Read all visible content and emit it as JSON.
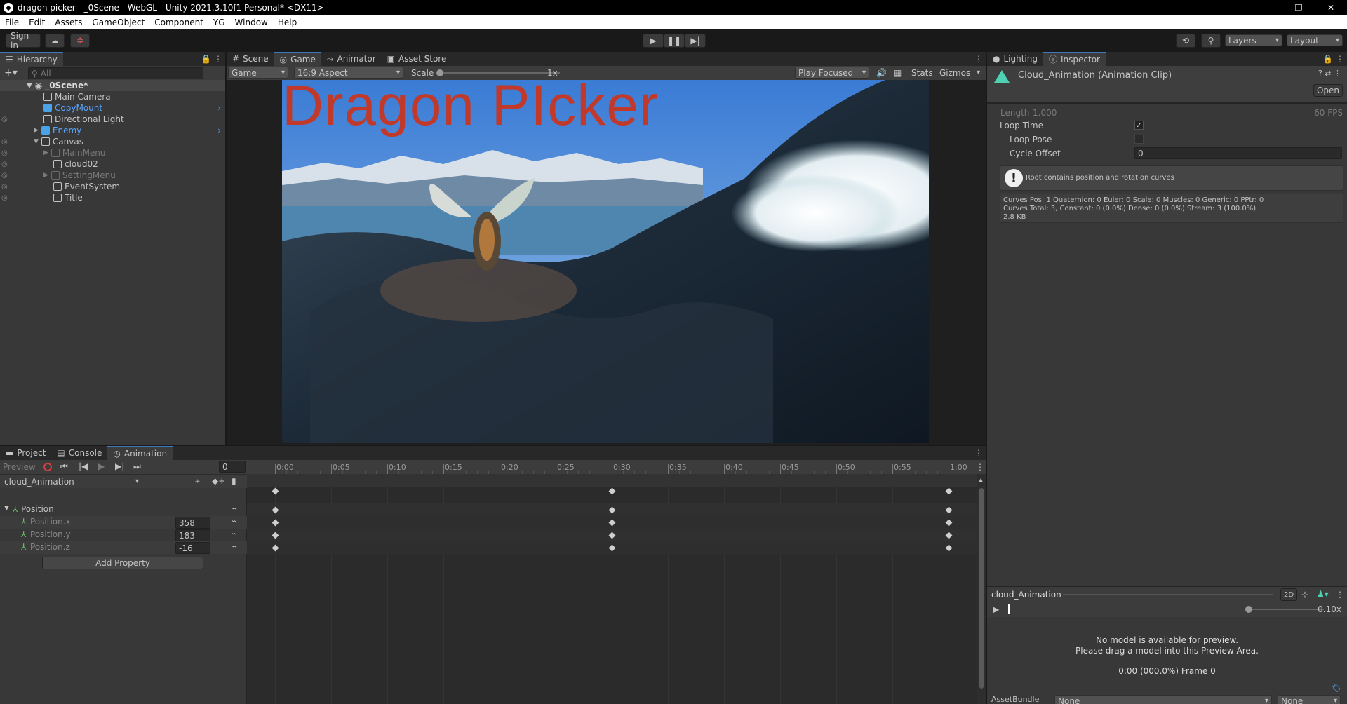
{
  "window": {
    "title": "dragon picker - _0Scene - WebGL - Unity 2021.3.10f1 Personal* <DX11>",
    "controls": [
      "—",
      "❐",
      "✕"
    ]
  },
  "menu": [
    "File",
    "Edit",
    "Assets",
    "GameObject",
    "Component",
    "YG",
    "Window",
    "Help"
  ],
  "toolbar": {
    "sign_in": "Sign in",
    "layers": "Layers",
    "layout": "Layout"
  },
  "hierarchy": {
    "tab": "Hierarchy",
    "search_placeholder": "All",
    "scene": "_0Scene*",
    "items": [
      {
        "label": "Main Camera",
        "color": "#c4c4c4"
      },
      {
        "label": "CopyMount",
        "color": "#58a6ff"
      },
      {
        "label": "Directional Light",
        "color": "#c4c4c4"
      },
      {
        "label": "Enemy",
        "color": "#58a6ff"
      },
      {
        "label": "Canvas",
        "color": "#c4c4c4"
      },
      {
        "label": "MainMenu",
        "color": "#7a7a7a"
      },
      {
        "label": "cloud02",
        "color": "#c4c4c4"
      },
      {
        "label": "SettingMenu",
        "color": "#7a7a7a"
      },
      {
        "label": "EventSystem",
        "color": "#c4c4c4"
      },
      {
        "label": "Title",
        "color": "#c4c4c4"
      }
    ]
  },
  "center_tabs": {
    "scene": "Scene",
    "game": "Game",
    "animator": "Animator",
    "asset_store": "Asset Store"
  },
  "game_toolbar": {
    "display": "Game",
    "aspect": "16:9 Aspect",
    "scale_label": "Scale",
    "scale_value": "1x",
    "play_mode": "Play Focused",
    "stats": "Stats",
    "gizmos": "Gizmos"
  },
  "game_view": {
    "title": "Dragon PIcker"
  },
  "right_tabs": {
    "lighting": "Lighting",
    "inspector": "Inspector"
  },
  "inspector": {
    "header": "Cloud_Animation (Animation Clip)",
    "open": "Open",
    "length_label": "Length",
    "length_value": "1.000",
    "fps": "60 FPS",
    "loop_time": "Loop Time",
    "loop_pose": "Loop Pose",
    "cycle_offset": "Cycle Offset",
    "cycle_offset_value": "0",
    "warning": "Root contains position and rotation curves",
    "curves_line1": "Curves Pos: 1 Quaternion: 0 Euler: 0 Scale: 0 Muscles: 0 Generic: 0 PPtr: 0",
    "curves_line2": "Curves Total: 3, Constant: 0 (0.0%) Dense: 0 (0.0%) Stream: 3 (100.0%)",
    "curves_line3": "2.8 KB"
  },
  "preview": {
    "clip": "cloud_Animation",
    "mode2d": "2D",
    "speed": "0.10x",
    "msg1": "No model is available for preview.",
    "msg2": "Please drag a model into this Preview Area.",
    "time": "0:00 (000.0%) Frame 0",
    "assetbundle_label": "AssetBundle",
    "assetbundle_value": "None",
    "variant_value": "None"
  },
  "bottom_tabs": {
    "project": "Project",
    "console": "Console",
    "animation": "Animation"
  },
  "animation": {
    "preview": "Preview",
    "frame": "0",
    "clip": "cloud_Animation",
    "property_group": "Position",
    "properties": [
      {
        "name": "Position.x",
        "value": "358"
      },
      {
        "name": "Position.y",
        "value": "183"
      },
      {
        "name": "Position.z",
        "value": "-16"
      }
    ],
    "add_property": "Add Property",
    "ticks": [
      "0:00",
      "0:05",
      "0:10",
      "0:15",
      "0:20",
      "0:25",
      "0:30",
      "0:35",
      "0:40",
      "0:45",
      "0:50",
      "0:55",
      "1:00"
    ]
  }
}
